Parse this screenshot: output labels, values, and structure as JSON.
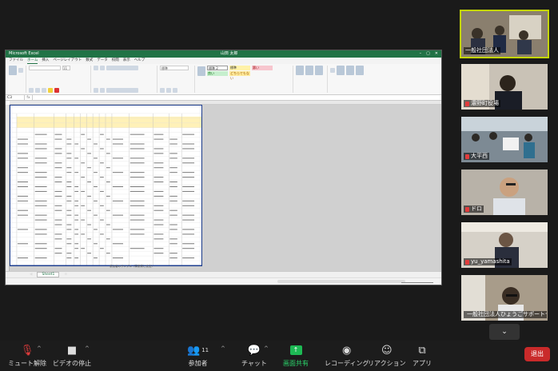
{
  "excel": {
    "title": "Microsoft Excel",
    "account": "山田 太郎",
    "tabs": [
      "ファイル",
      "ホーム",
      "挿入",
      "ページレイアウト",
      "数式",
      "データ",
      "校閲",
      "表示",
      "ヘルプ"
    ],
    "active_tab": "ホーム",
    "font_size": "11",
    "number_format": "標準",
    "styles": [
      "標準 2",
      "標準",
      "悪い",
      "良い",
      "どちらでもない"
    ],
    "name_box": "C3",
    "sheet_tab": "Sheet1",
    "sheet_caption": "参加者のサンプル（事業費と支出）"
  },
  "gallery": {
    "participants": [
      {
        "name": "一般社団法人",
        "speaking": true
      },
      {
        "name": "濃野町役場"
      },
      {
        "name": "大平西"
      },
      {
        "name": "ドロ"
      },
      {
        "name": "yu_yamashita"
      },
      {
        "name": "一般社団法人ひょうごサポートセンター"
      }
    ],
    "scroll_icon": "chevron-down-icon"
  },
  "toolbar": {
    "mute": "ミュート解除",
    "video": "ビデオの停止",
    "participants": "参加者",
    "participants_count": "11",
    "chat": "チャット",
    "share": "画面共有",
    "record": "レコーディング",
    "reactions": "リアクション",
    "apps": "アプリ",
    "end": "退出"
  },
  "colors": {
    "excel_green": "#217346",
    "share_green": "#1db954",
    "end_red": "#c92a2a",
    "speaker_outline": "#c4d600"
  }
}
